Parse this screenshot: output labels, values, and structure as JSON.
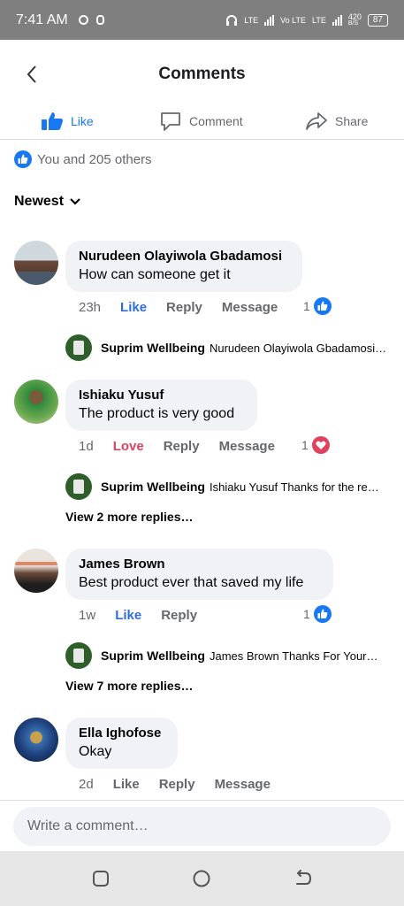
{
  "status_bar": {
    "time": "7:41 AM",
    "net1": "LTE",
    "net2": "Vo LTE",
    "net3": "LTE",
    "speed": "420",
    "speed_unit": "B/S",
    "battery": "87"
  },
  "header": {
    "title": "Comments"
  },
  "actions": {
    "like": "Like",
    "comment": "Comment",
    "share": "Share"
  },
  "reactions": {
    "summary": "You and 205 others"
  },
  "sort": {
    "label": "Newest"
  },
  "comments": [
    {
      "name": "Nurudeen Olayiwola Gbadamosi",
      "text": "How can someone get it",
      "time": "23h",
      "reaction_label": "Like",
      "reply": "Reply",
      "message": "Message",
      "count": "1",
      "reply_preview": {
        "name": "Suprim Wellbeing",
        "text": "Nurudeen Olayiwola Gbadamosi"
      }
    },
    {
      "name": "Ishiaku Yusuf",
      "text": "The product is very good",
      "time": "1d",
      "reaction_label": "Love",
      "reply": "Reply",
      "message": "Message",
      "count": "1",
      "reply_preview": {
        "name": "Suprim Wellbeing",
        "text": "Ishiaku Yusuf Thanks for the re…"
      },
      "view_more": "View 2 more replies…"
    },
    {
      "name": "James Brown",
      "text": "Best product ever that saved my life",
      "time": "1w",
      "reaction_label": "Like",
      "reply": "Reply",
      "count": "1",
      "reply_preview": {
        "name": "Suprim Wellbeing",
        "text": "James Brown Thanks For Your…"
      },
      "view_more": "View 7 more replies…"
    },
    {
      "name": "Ella Ighofose",
      "text": "Okay",
      "time": "2d",
      "reaction_label": "Like",
      "reply": "Reply",
      "message": "Message"
    }
  ],
  "composer": {
    "placeholder": "Write a comment…"
  },
  "colors": {
    "accent": "#1877f2",
    "love": "#e0415e",
    "bubble": "#f0f2f5"
  }
}
